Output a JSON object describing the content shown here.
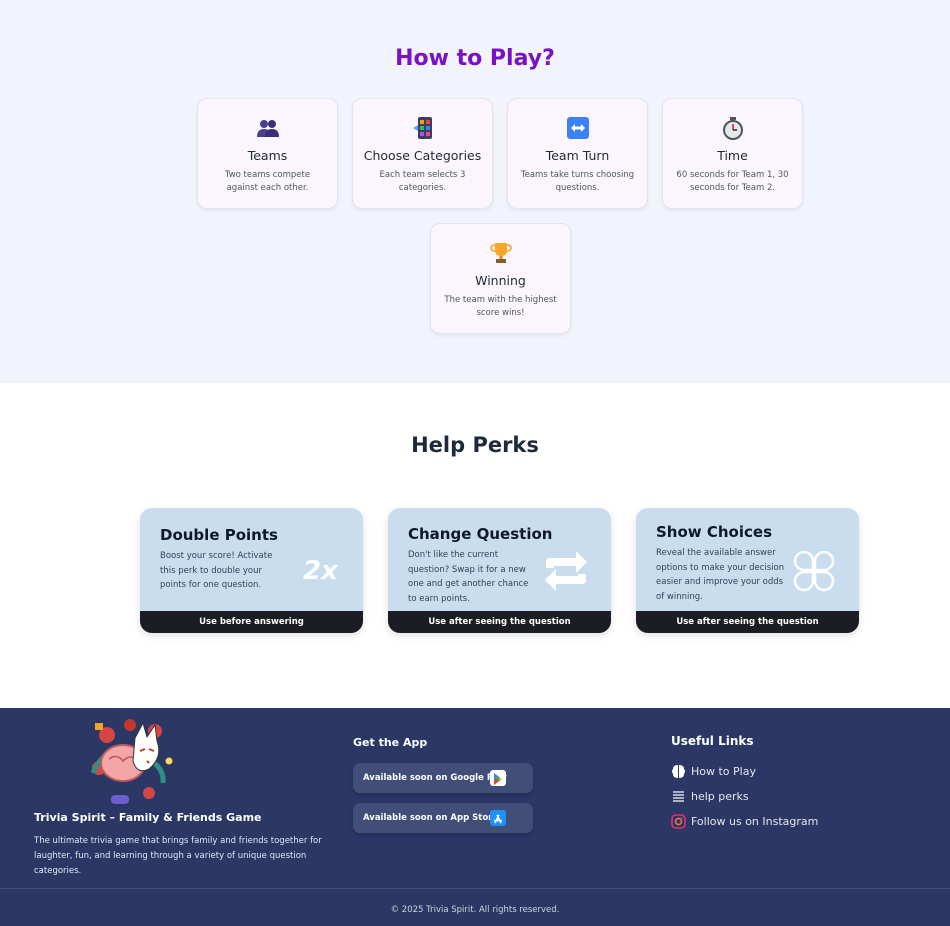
{
  "how_to_play": {
    "title": "How to Play?",
    "cards": [
      {
        "icon": "people-icon",
        "title": "Teams",
        "desc": "Two teams compete against each other."
      },
      {
        "icon": "phone-grid-icon",
        "title": "Choose Categories",
        "desc": "Each team selects 3 categories."
      },
      {
        "icon": "left-right-arrow-icon",
        "title": "Team Turn",
        "desc": "Teams take turns choosing questions."
      },
      {
        "icon": "stopwatch-icon",
        "title": "Time",
        "desc": "60 seconds for Team 1, 30 seconds for Team 2."
      },
      {
        "icon": "trophy-icon",
        "title": "Winning",
        "desc": "The team with the highest score wins!"
      }
    ]
  },
  "help_perks": {
    "title": "Help Perks",
    "perks": [
      {
        "icon": "double-points-icon",
        "icon_text": "2x",
        "title": "Double Points",
        "desc": "Boost your score! Activate this perk to double your points for one question.",
        "usage": "Use before answering"
      },
      {
        "icon": "swap-icon",
        "title": "Change Question",
        "desc": "Don't like the current question? Swap it for a new one and get another chance to earn points.",
        "usage": "Use after seeing the question"
      },
      {
        "icon": "clover-icon",
        "title": "Show Choices",
        "desc": "Reveal the available answer options to make your decision easier and improve your odds of winning.",
        "usage": "Use after seeing the question"
      }
    ]
  },
  "footer": {
    "brand": "Trivia Spirit – Family & Friends Game",
    "blurb": "The ultimate trivia game that brings family and friends together for laughter, fun, and learning through a variety of unique question categories.",
    "get_app": {
      "title": "Get the App",
      "google_play": "Available soon on Google Play",
      "app_store": "Available soon on App Store"
    },
    "useful_links": {
      "title": "Useful Links",
      "items": [
        {
          "icon": "brain-icon",
          "label": "How to Play"
        },
        {
          "icon": "list-icon",
          "label": "help perks"
        },
        {
          "icon": "instagram-icon",
          "label": "Follow us on Instagram"
        }
      ]
    },
    "copyright": "© 2025 Trivia Spirit. All rights reserved."
  },
  "colors": {
    "title_purple": "#7a12c4",
    "perk_card": "#c9ddef",
    "perk_bar": "#1c1c24",
    "footer_bg": "#2b3866"
  }
}
